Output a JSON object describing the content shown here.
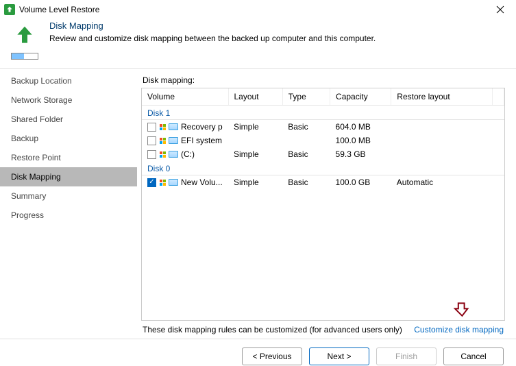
{
  "window": {
    "title": "Volume Level Restore"
  },
  "header": {
    "title": "Disk Mapping",
    "subtitle": "Review and customize disk mapping between the backed up computer and this computer."
  },
  "sidebar": {
    "items": [
      {
        "label": "Backup Location"
      },
      {
        "label": "Network Storage"
      },
      {
        "label": "Shared Folder"
      },
      {
        "label": "Backup"
      },
      {
        "label": "Restore Point"
      },
      {
        "label": "Disk Mapping"
      },
      {
        "label": "Summary"
      },
      {
        "label": "Progress"
      }
    ],
    "activeIndex": 5
  },
  "table": {
    "label": "Disk mapping:",
    "columns": [
      "Volume",
      "Layout",
      "Type",
      "Capacity",
      "Restore layout"
    ],
    "groups": [
      {
        "name": "Disk 1",
        "rows": [
          {
            "checked": false,
            "name": "Recovery p...",
            "layout": "Simple",
            "type": "Basic",
            "capacity": "604.0 MB",
            "restore": ""
          },
          {
            "checked": false,
            "name": "EFI system ...",
            "layout": "",
            "type": "",
            "capacity": "100.0 MB",
            "restore": ""
          },
          {
            "checked": false,
            "name": "(C:)",
            "layout": "Simple",
            "type": "Basic",
            "capacity": "59.3 GB",
            "restore": ""
          }
        ]
      },
      {
        "name": "Disk 0",
        "rows": [
          {
            "checked": true,
            "name": "New Volu...",
            "layout": "Simple",
            "type": "Basic",
            "capacity": "100.0 GB",
            "restore": "Automatic"
          }
        ]
      }
    ]
  },
  "footer": {
    "note": "These disk mapping rules can be customized (for advanced users only)",
    "link": "Customize disk mapping"
  },
  "buttons": {
    "previous": "<  Previous",
    "next": "Next  >",
    "finish": "Finish",
    "cancel": "Cancel"
  }
}
